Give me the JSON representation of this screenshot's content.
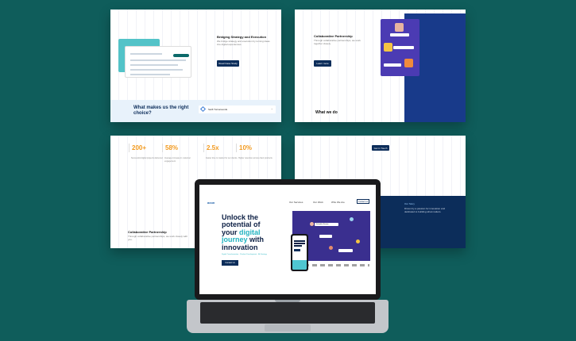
{
  "panel1": {
    "mock_title": "Bridging Strategy and Execution",
    "body": "We bridge strategy and execution by turning ideas into digital experiences.",
    "button": "Read Case Study",
    "section_title": "What makes us the right choice?",
    "accordion_item": "Swift Turnarounds"
  },
  "panel2": {
    "title": "Collaborative Partnership",
    "body": "Through collaborative partnerships, we work together closely.",
    "button": "Learn more",
    "section_title": "What we do"
  },
  "panel3": {
    "stats": [
      {
        "value": "200+",
        "desc": "Successful digital projects delivered."
      },
      {
        "value": "58%",
        "desc": "Average increase in customer engagement."
      },
      {
        "value": "2.5x",
        "desc": "Faster time to market for our clients."
      },
      {
        "value": "10%",
        "desc": "Higher retention across client products."
      }
    ],
    "title": "Collaborative Partnership",
    "body": "Through collaborative partnerships, we work closely with you."
  },
  "panel4": {
    "button": "Get in Touch",
    "label": "Our Story",
    "body": "Driven by a passion for innovation and dedicated to building what matters."
  },
  "laptop": {
    "logo": "axon",
    "nav": [
      "Our Services",
      "Our Work",
      "Who We Are"
    ],
    "nav_button": "Contact us",
    "hero_line1": "Unlock the",
    "hero_line2": "potential of",
    "hero_line3_prefix": "your ",
    "hero_line3_highlight": "digital",
    "hero_line4_highlight": "journey",
    "hero_line4_suffix": " with",
    "hero_line5": "innovation",
    "sublinks": "Digital Transformation · Product Development · AI Strategy",
    "cta": "Contact Us",
    "dark_panel_label": "Schedule Review"
  },
  "colors": {
    "background": "#0f5d5b",
    "navy": "#0c2d5a",
    "accent_orange": "#f29a1f",
    "accent_cyan": "#22b3c1",
    "purple": "#4b3bb3"
  }
}
